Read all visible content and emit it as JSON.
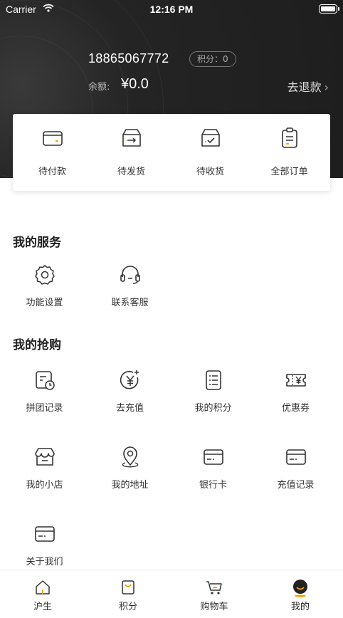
{
  "status_bar": {
    "carrier": "Carrier",
    "time": "12:16 PM"
  },
  "profile": {
    "phone": "18865067772",
    "points_badge": "积分：0",
    "balance_label": "余额:",
    "balance_value": "¥0.0",
    "refund_link": "去退款",
    "refund_chevron": "›"
  },
  "orders": [
    {
      "label": "待付款",
      "icon": "wallet-icon"
    },
    {
      "label": "待发货",
      "icon": "box-arrow-icon"
    },
    {
      "label": "待收货",
      "icon": "box-check-icon"
    },
    {
      "label": "全部订单",
      "icon": "clipboard-icon"
    }
  ],
  "services": {
    "title": "我的服务",
    "items": [
      {
        "label": "功能设置",
        "icon": "gear-icon"
      },
      {
        "label": "联系客服",
        "icon": "headset-icon"
      }
    ]
  },
  "purchases": {
    "title": "我的抢购",
    "items": [
      {
        "label": "拼团记录",
        "icon": "calendar-clock-icon"
      },
      {
        "label": "去充值",
        "icon": "yuan-plus-icon"
      },
      {
        "label": "我的积分",
        "icon": "list-doc-icon"
      },
      {
        "label": "优惠券",
        "icon": "ticket-yuan-icon"
      },
      {
        "label": "我的小店",
        "icon": "store-icon"
      },
      {
        "label": "我的地址",
        "icon": "map-pin-icon"
      },
      {
        "label": "银行卡",
        "icon": "bank-card-icon"
      },
      {
        "label": "充值记录",
        "icon": "recharge-card-icon"
      },
      {
        "label": "关于我们",
        "icon": "about-card-icon"
      }
    ]
  },
  "tabbar": [
    {
      "label": "沪生",
      "icon": "home-icon",
      "active": false
    },
    {
      "label": "积分",
      "icon": "points-bag-icon",
      "active": false
    },
    {
      "label": "购物车",
      "icon": "cart-icon",
      "active": false
    },
    {
      "label": "我的",
      "icon": "profile-icon",
      "active": true
    }
  ],
  "colors": {
    "header_bg": "#222222",
    "accent": "#f0a000",
    "text": "#333333"
  }
}
